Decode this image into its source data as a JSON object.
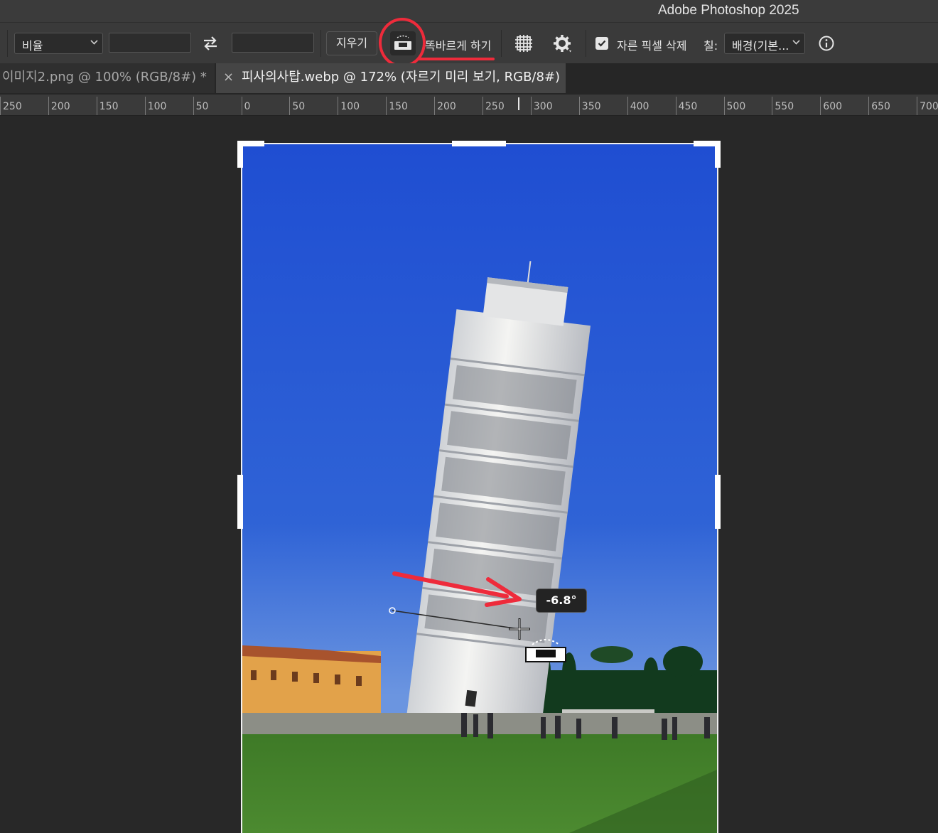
{
  "app": {
    "title": "Adobe Photoshop 2025"
  },
  "options_bar": {
    "ratio_select": "비율",
    "width_value": "",
    "height_value": "",
    "clear_button": "지우기",
    "straighten_label": "똑바르게 하기",
    "delete_cropped_pixels_label": "자른 픽셀 삭제",
    "delete_cropped_pixels_checked": true,
    "fill_label": "칠:",
    "fill_select": "배경(기본..."
  },
  "tabs": [
    {
      "label": "이미지2.png @ 100% (RGB/8#) *",
      "active": false
    },
    {
      "label": "피사의사탑.webp @ 172% (자르기 미리 보기, RGB/8#)",
      "active": true,
      "close": "×"
    }
  ],
  "ruler": {
    "labels": [
      "250",
      "200",
      "150",
      "100",
      "50",
      "0",
      "50",
      "100",
      "150",
      "200",
      "250",
      "300",
      "350",
      "400",
      "450",
      "500",
      "550",
      "600",
      "650",
      "700"
    ]
  },
  "canvas": {
    "straighten_angle": "-6.8°"
  },
  "colors": {
    "annotation": "#ee2b3b",
    "sky": "#2f63d6",
    "grass": "#4c8a30"
  }
}
